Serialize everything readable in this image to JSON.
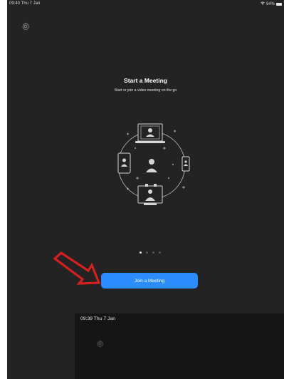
{
  "status_bar": {
    "time": "09:40  Thu 7 Jan",
    "battery": "94%",
    "wifi_icon": "wifi-icon",
    "battery_icon": "battery-icon"
  },
  "settings_icon": "gear-icon",
  "main": {
    "title": "Start a Meeting",
    "subtitle": "Start or join a video meeting on the go",
    "illustration": "meeting-network-illustration",
    "page_indicator": {
      "count": 4,
      "active": 0
    },
    "join_button": "Join a Meeting"
  },
  "annotation": {
    "arrow_color": "#d42020",
    "arrow_icon": "arrow-icon"
  },
  "overlay_screen": {
    "time": "09:39  Thu 7 Jan",
    "settings_icon": "gear-icon"
  },
  "colors": {
    "background": "#232323",
    "accent": "#2d8cff",
    "overlay_bg": "#151515"
  }
}
